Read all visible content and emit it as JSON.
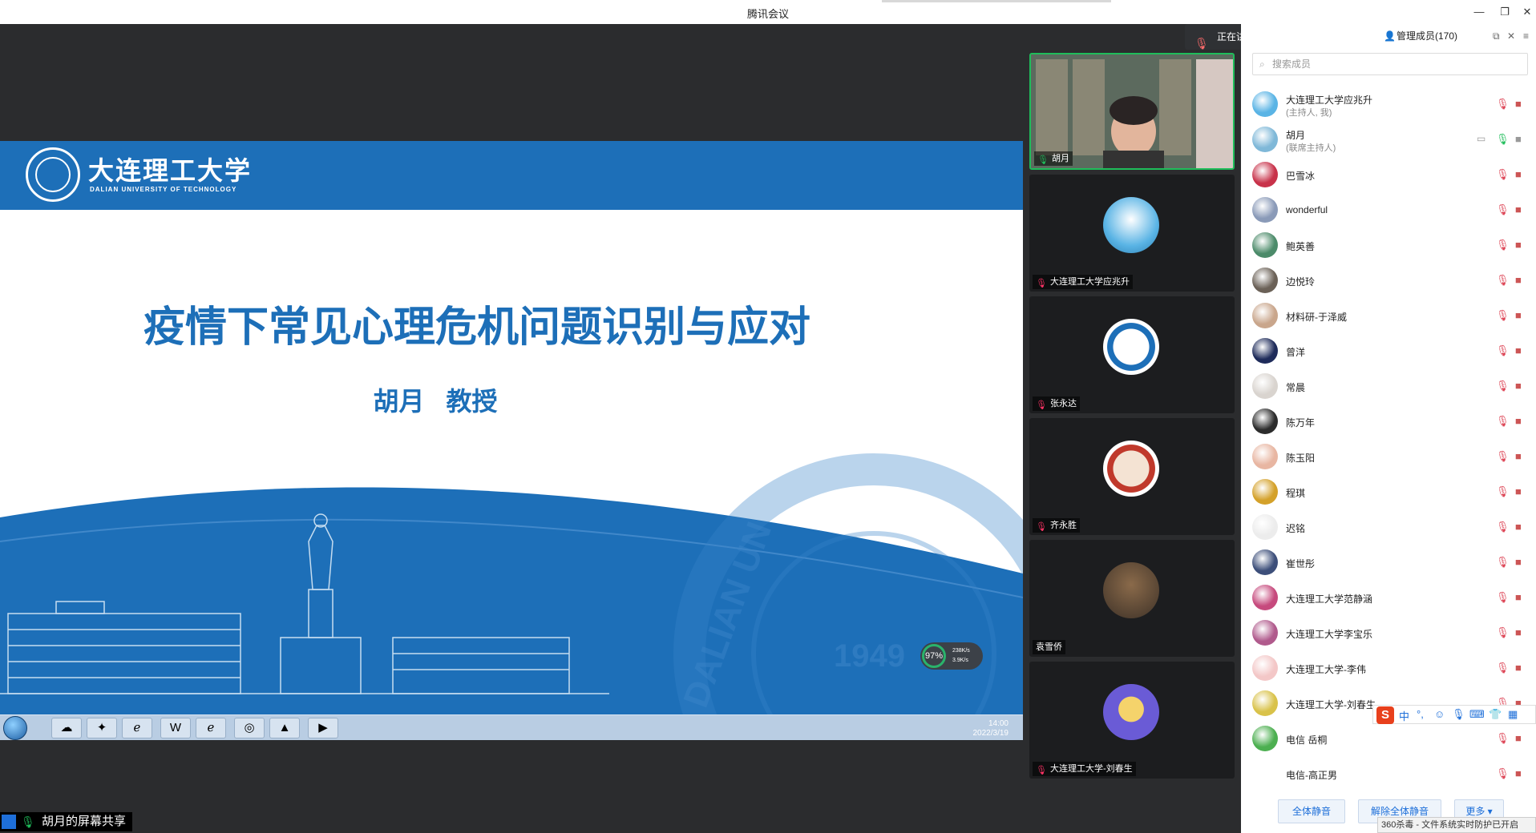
{
  "window": {
    "title": "腾讯会议",
    "minimize": "—",
    "restore": "❐",
    "close": "✕"
  },
  "slide": {
    "university_name_cn": "大连理工大学",
    "university_name_en": "DALIAN UNIVERSITY OF TECHNOLOGY",
    "title": "疫情下常见心理危机问题识别与应对",
    "author": "胡月 教授",
    "watermark_year": "1949",
    "watermark_text": "DALIAN UN"
  },
  "taskbar": {
    "clock_time": "14:00",
    "clock_date": "2022/3/19"
  },
  "speed_widget": {
    "percent": "97%",
    "upload": "238K/s",
    "download": "3.9K/s"
  },
  "share_label": "胡月的屏幕共享",
  "speaking": {
    "label": "正在讲话: 胡月;"
  },
  "panel": {
    "header": "管理成员(170)",
    "search_placeholder": "搜索成员",
    "mute_all": "全体静音",
    "unmute_all": "解除全体静音",
    "more": "更多 ▾"
  },
  "video_tiles": [
    {
      "name": "胡月"
    },
    {
      "name": "大连理工大学应兆升"
    },
    {
      "name": "张永达"
    },
    {
      "name": "齐永胜"
    },
    {
      "name": "袁雪侨"
    },
    {
      "name": "大连理工大学-刘春生"
    }
  ],
  "members": [
    {
      "name": "大连理工大学应兆升",
      "role": "(主持人, 我)",
      "color": "#5ab4e5"
    },
    {
      "name": "胡月",
      "role": "(联席主持人)",
      "color": "#7fb8d8"
    },
    {
      "name": "巴雪冰",
      "role": "",
      "color": "#c8324a"
    },
    {
      "name": "wonderful",
      "role": "",
      "color": "#8a9ab8"
    },
    {
      "name": "鲍英善",
      "role": "",
      "color": "#4c8b6a"
    },
    {
      "name": "边悦玲",
      "role": "",
      "color": "#6b6157"
    },
    {
      "name": "材料研-于泽威",
      "role": "",
      "color": "#c9a68c"
    },
    {
      "name": "曾洋",
      "role": "",
      "color": "#1e2b5a"
    },
    {
      "name": "常晨",
      "role": "",
      "color": "#d9d4cf"
    },
    {
      "name": "陈万年",
      "role": "",
      "color": "#2c2c2c"
    },
    {
      "name": "陈玉阳",
      "role": "",
      "color": "#e8b6a2"
    },
    {
      "name": "程琪",
      "role": "",
      "color": "#d4a12a"
    },
    {
      "name": "迟铭",
      "role": "",
      "color": "#ececec"
    },
    {
      "name": "崔世彤",
      "role": "",
      "color": "#3d4f7a"
    },
    {
      "name": "大连理工大学范静涵",
      "role": "",
      "color": "#c64a7d"
    },
    {
      "name": "大连理工大学李宝乐",
      "role": "",
      "color": "#b05a8c"
    },
    {
      "name": "大连理工大学-李伟",
      "role": "",
      "color": "#f3c7c7"
    },
    {
      "name": "大连理工大学-刘春生",
      "role": "",
      "color": "#d9c24a"
    },
    {
      "name": "电信 岳桐",
      "role": "",
      "color": "#4caf50"
    },
    {
      "name": "电信-高正男",
      "role": "",
      "color": "#ffffff"
    }
  ],
  "ime": {
    "logo": "S",
    "mode": "中"
  },
  "toast": "360杀毒 - 文件系统实时防护已开启"
}
